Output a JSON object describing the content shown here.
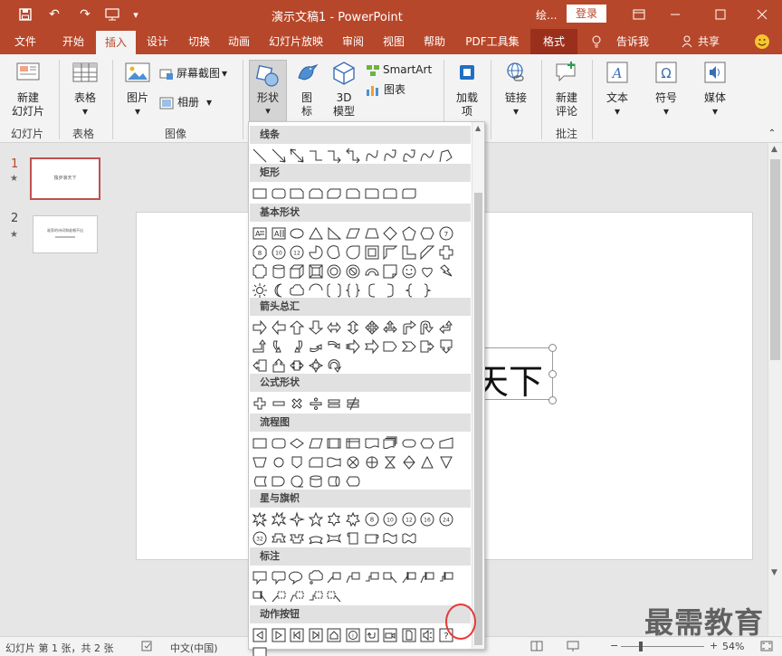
{
  "titlebar": {
    "doc_title": "演示文稿1 - PowerPoint",
    "account_label": "绘...",
    "login": "登录",
    "qa_customize": "▾"
  },
  "tabs": [
    "文件",
    "开始",
    "插入",
    "设计",
    "切换",
    "动画",
    "幻灯片放映",
    "审阅",
    "视图",
    "帮助",
    "PDF工具集",
    "格式"
  ],
  "tell_me": "告诉我",
  "share": "共享",
  "ribbon": {
    "new_slide_1": "新建",
    "new_slide_2": "幻灯片",
    "group_slides": "幻灯片",
    "table": "表格",
    "group_tables": "表格",
    "pictures": "图片",
    "screenshot": "屏幕截图",
    "album": "相册",
    "group_images": "图像",
    "shapes": "形状",
    "icons_1": "图",
    "icons_2": "标",
    "model_1": "3D",
    "model_2": "模型",
    "smartart": "SmartArt",
    "chart": "图表",
    "addin_1": "加载",
    "addin_2": "项",
    "link": "链接",
    "comment_1": "新建",
    "comment_2": "评论",
    "group_comments": "批注",
    "text": "文本",
    "symbol": "符号",
    "media": "媒体"
  },
  "gallery": {
    "sections": [
      {
        "title": "线条",
        "shapes": [
          "line",
          "line-arrow",
          "line-double-arrow",
          "elbow",
          "elbow-arrow",
          "elbow-double",
          "curve",
          "curve-arrow",
          "curve-double",
          "freeform-curve",
          "freeform",
          "scribble"
        ]
      },
      {
        "title": "矩形",
        "shapes": [
          "rect",
          "rounded-rect",
          "snip-rect",
          "snip-2",
          "snip-diag",
          "round-snip",
          "round-1",
          "round-2",
          "round-diag"
        ]
      },
      {
        "title": "基本形状",
        "shapes": [
          "textbox",
          "vtextbox",
          "ellipse",
          "tri",
          "rtri",
          "parallelogram",
          "trapezoid",
          "diamond",
          "pentagon",
          "hexagon",
          "heptagon",
          "octagon",
          "decagon",
          "dodecagon",
          "pie",
          "chord",
          "teardrop",
          "frame",
          "half-frame",
          "l-shape",
          "diag-stripe",
          "cross",
          "plaque",
          "can",
          "cube",
          "bevel",
          "donut",
          "no-symbol",
          "block-arc",
          "folded",
          "smiley",
          "heart",
          "lightning",
          "sun",
          "moon",
          "cloud",
          "arc",
          "dbl-bracket",
          "dbl-brace",
          "lbracket",
          "rbracket",
          "lbrace",
          "rbrace"
        ]
      },
      {
        "title": "箭头总汇",
        "shapes": [
          "rarrow",
          "larrow",
          "uarrow",
          "darrow",
          "lrarrow",
          "udarrow",
          "quadarrow",
          "lruarrow",
          "bentarrow",
          "uturn",
          "lupcurved",
          "bentup",
          "curvedr",
          "curvedl",
          "curvedu",
          "curvedd",
          "striped",
          "notched",
          "homeplate",
          "chevron",
          "rcallout",
          "dcallout",
          "lcallout",
          "ucallout",
          "lrcallout",
          "quadcallout",
          "circular"
        ]
      },
      {
        "title": "公式形状",
        "shapes": [
          "plus",
          "minus",
          "multiply",
          "divide",
          "equal",
          "notequal"
        ]
      },
      {
        "title": "流程图",
        "shapes": [
          "process",
          "alt-process",
          "decision",
          "data",
          "predefined",
          "internal",
          "document",
          "multidoc",
          "terminator",
          "preparation",
          "manual-input",
          "manual-op",
          "connector",
          "offpage",
          "card",
          "punched-tape",
          "summing",
          "or",
          "collate",
          "sort",
          "extract",
          "merge",
          "stored-data",
          "delay",
          "seq-storage",
          "magnetic-disk",
          "direct-access",
          "display"
        ]
      },
      {
        "title": "星与旗帜",
        "shapes": [
          "explosion1",
          "explosion2",
          "star4",
          "star5",
          "star6",
          "star7",
          "star8",
          "star10",
          "star12",
          "star16",
          "star24",
          "star32",
          "ribbon-up",
          "ribbon-down",
          "curved-ribbon-up",
          "curved-ribbon-down",
          "vscroll",
          "hscroll",
          "wave",
          "dwave"
        ]
      },
      {
        "title": "标注",
        "shapes": [
          "rect-callout",
          "round-callout",
          "oval-callout",
          "cloud-callout",
          "line-callout1",
          "line-callout2",
          "line-callout3",
          "line-callout4",
          "acc-callout1",
          "acc-callout2",
          "acc-callout3",
          "acc-callout4",
          "border-callout1",
          "border-callout2",
          "border-callout3",
          "border-callout4"
        ]
      },
      {
        "title": "动作按钮",
        "shapes": [
          "ab-back",
          "ab-forward",
          "ab-begin",
          "ab-end",
          "ab-home",
          "ab-info",
          "ab-return",
          "ab-movie",
          "ab-document",
          "ab-sound",
          "ab-help",
          "ab-custom"
        ]
      }
    ]
  },
  "slides": [
    {
      "number": "1",
      "thumb_text": "独步浪天下"
    },
    {
      "number": "2",
      "thumb_text": "谁家的诗词和谁唱不出"
    }
  ],
  "slide_text": "天下",
  "status": {
    "slide_info": "幻灯片 第 1 张，共 2 张",
    "language": "中文(中国)",
    "zoom": "54%"
  },
  "watermark": "最需教育",
  "colors": {
    "accent": "#b7472a",
    "highlight": "#e53935"
  }
}
